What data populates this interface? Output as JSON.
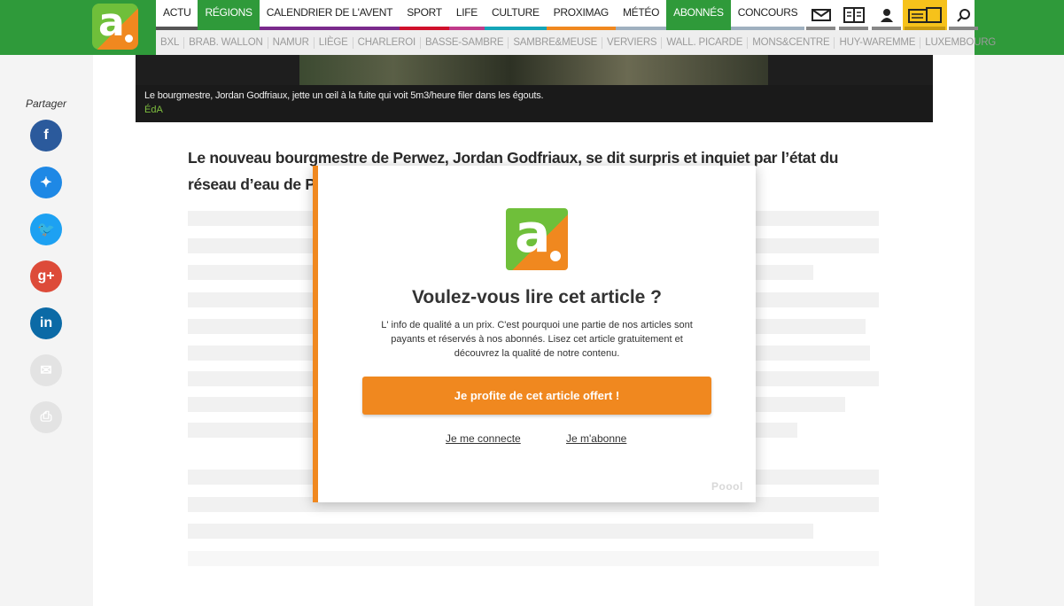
{
  "brand": {
    "logo_letter": "a"
  },
  "nav": {
    "main": [
      {
        "label": "ACTU",
        "color": "#555555"
      },
      {
        "label": "RÉGIONS",
        "color": "#2f9a3a",
        "active": true
      },
      {
        "label": "CALENDRIER DE L'AVENT",
        "color": "#7a2a8c"
      },
      {
        "label": "SPORT",
        "color": "#d0102b"
      },
      {
        "label": "LIFE",
        "color": "#c03a8a"
      },
      {
        "label": "CULTURE",
        "color": "#14a5b8"
      },
      {
        "label": "PROXIMAG",
        "color": "#f0881f"
      },
      {
        "label": "MÉTÉO",
        "color": "#9fb0bf"
      },
      {
        "label": "ABONNÉS",
        "color": "#2f9a3a",
        "active": true
      },
      {
        "label": "CONCOURS",
        "color": "#9fb0bf"
      }
    ],
    "icons": [
      {
        "icon": "envelope-icon",
        "glyph": "✉"
      },
      {
        "icon": "newspaper-icon",
        "glyph": "📰"
      },
      {
        "icon": "user-icon",
        "glyph": "👤"
      },
      {
        "icon": "journal-devices-icon",
        "glyph": "▭"
      },
      {
        "icon": "search-icon",
        "glyph": "⌕"
      }
    ],
    "sub": [
      "BXL",
      "BRAB. WALLON",
      "NAMUR",
      "LIÈGE",
      "CHARLEROI",
      "BASSE-SAMBRE",
      "SAMBRE&MEUSE",
      "VERVIERS",
      "WALL. PICARDE",
      "MONS&CENTRE",
      "HUY-WAREMME",
      "LUXEMBOURG"
    ]
  },
  "share": {
    "title": "Partager",
    "buttons": [
      {
        "name": "facebook",
        "glyph": "f",
        "color": "#2b5a9c"
      },
      {
        "name": "messenger",
        "glyph": "✦",
        "color": "#1e88e5"
      },
      {
        "name": "twitter",
        "glyph": "🐦",
        "color": "#1da1f2"
      },
      {
        "name": "google-plus",
        "glyph": "g+",
        "color": "#dd4b39"
      },
      {
        "name": "linkedin",
        "glyph": "in",
        "color": "#0b6aa6"
      },
      {
        "name": "email",
        "glyph": "✉",
        "color": "#e3e3e3"
      },
      {
        "name": "print",
        "glyph": "⎙",
        "color": "#e3e3e3"
      }
    ]
  },
  "article": {
    "caption": "Le bourgmestre, Jordan Godfriaux, jette un œil à la fuite qui voit 5m3/heure filer dans les égouts.",
    "credit": "ÉdA",
    "lead": "Le nouveau bourgmestre de Perwez, Jordan Godfriaux, se dit surpris et inquiet par l’état du réseau d’eau de Perwez."
  },
  "paywall": {
    "title": "Voulez-vous lire cet article ?",
    "text": "L' info de qualité a un prix. C'est pourquoi une partie de nos articles sont payants et réservés à nos abonnés. Lisez cet article gratuitement et découvrez la qualité de notre contenu.",
    "cta": "Je profite de cet article offert !",
    "login": "Je me connecte",
    "subscribe": "Je m'abonne",
    "provider": "Poool"
  }
}
